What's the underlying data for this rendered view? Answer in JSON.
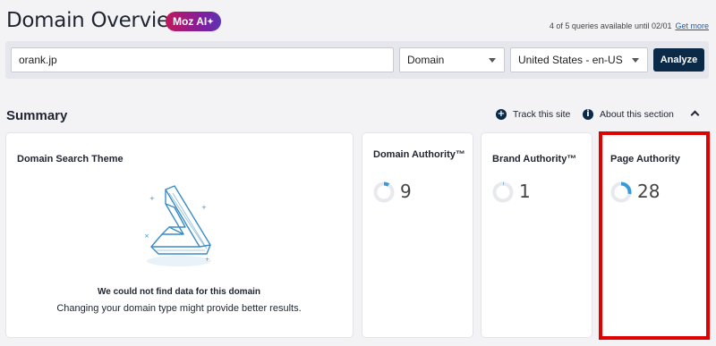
{
  "header": {
    "title": "Domain Overview",
    "ai_badge": "Moz AI",
    "ai_badge_icon": "sparkle-icon",
    "quota_text": "4 of 5 queries available until 02/01",
    "quota_link": "Get more"
  },
  "search": {
    "domain_value": "orank.jp",
    "type_selected": "Domain",
    "locale_selected": "United States - en-US",
    "analyze_label": "Analyze"
  },
  "summary": {
    "heading": "Summary",
    "track_label": "Track this site",
    "about_label": "About this section"
  },
  "theme_card": {
    "title": "Domain Search Theme",
    "empty_title": "We could not find data for this domain",
    "empty_hint": "Changing your domain type might provide better results."
  },
  "metrics": [
    {
      "title": "Domain Authority™",
      "value": "9",
      "score": 9
    },
    {
      "title": "Brand Authority™",
      "value": "1",
      "score": 1
    },
    {
      "title": "Page Authority",
      "value": "28",
      "score": 28
    }
  ],
  "colors": {
    "accent": "#3a9ad9",
    "track": "#e8e9ee",
    "highlight": "#e10000",
    "button": "#0b2a47"
  }
}
